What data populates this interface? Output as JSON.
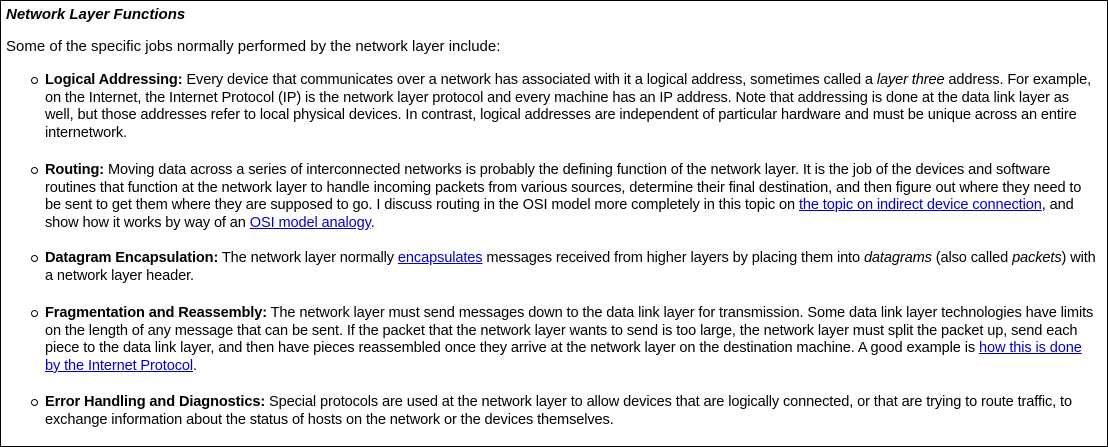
{
  "heading": "Network Layer Functions",
  "intro": "Some of the specific jobs normally performed by the network layer include:",
  "items": [
    {
      "title": "Logical Addressing:",
      "t1": " Every device that communicates over a network has associated with it a logical address, sometimes called a ",
      "em1": "layer three",
      "t2": " address. For example, on the Internet, the Internet Protocol (IP) is the network layer protocol and every machine has an IP address. Note that addressing is done at the data link layer as well, but those addresses refer to local physical devices. In contrast, logical addresses are independent of particular hardware and must be unique across an entire internetwork."
    },
    {
      "title": "Routing:",
      "t1": " Moving data across a series of interconnected networks is probably the defining function of the network layer. It is the job of the devices and software routines that function at the network layer to handle incoming packets from various sources, determine their final destination, and then figure out where they need to be sent to get them where they are supposed to go. I discuss routing in the OSI model more completely in this topic on ",
      "link1": "the topic on indirect device connection",
      "t2": ", and show how it works by way of an ",
      "link2": "OSI model analogy",
      "t3": "."
    },
    {
      "title": "Datagram Encapsulation:",
      "t1": " The network layer normally ",
      "link1": "encapsulates",
      "t2": " messages received from higher layers by placing them into ",
      "em1": "datagrams",
      "t3": " (also called ",
      "em2": "packets",
      "t4": ") with a network layer header."
    },
    {
      "title": "Fragmentation and Reassembly:",
      "t1": " The network layer must send messages down to the data link layer for transmission. Some data link layer technologies have limits on the length of any message that can be sent. If the packet that the network layer wants to send is too large, the network layer must split the packet up, send each piece to the data link layer, and then have pieces reassembled once they arrive at the network layer on the destination machine. A good example is ",
      "link1": "how this is done by the Internet Protocol",
      "t2": "."
    },
    {
      "title": "Error Handling and Diagnostics:",
      "t1": " Special protocols are used at the network layer to allow devices that are logically connected, or that are trying to route traffic, to exchange information about the status of hosts on the network or the devices themselves."
    }
  ]
}
